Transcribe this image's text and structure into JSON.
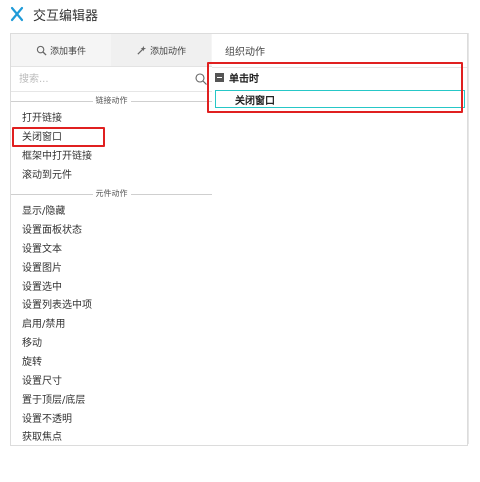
{
  "window": {
    "title": "交互编辑器"
  },
  "tabs": [
    {
      "label": "添加事件",
      "icon": "add-event-icon"
    },
    {
      "label": "添加动作",
      "icon": "add-action-icon"
    }
  ],
  "search": {
    "placeholder": "搜索..."
  },
  "sections": [
    {
      "title": "链接动作",
      "items": [
        "打开链接",
        "关闭窗口",
        "框架中打开链接",
        "滚动到元件"
      ]
    },
    {
      "title": "元件动作",
      "items": [
        "显示/隐藏",
        "设置面板状态",
        "设置文本",
        "设置图片",
        "设置选中",
        "设置列表选中项",
        "启用/禁用",
        "移动",
        "旋转",
        "设置尺寸",
        "置于顶层/底层",
        "设置不透明",
        "获取焦点"
      ]
    }
  ],
  "organize": {
    "header": "组织动作",
    "event": {
      "label": "单击时"
    },
    "action": {
      "label": "关闭窗口"
    }
  },
  "colors": {
    "highlight_red": "#e02020",
    "selection_cyan": "#26c7c7"
  }
}
